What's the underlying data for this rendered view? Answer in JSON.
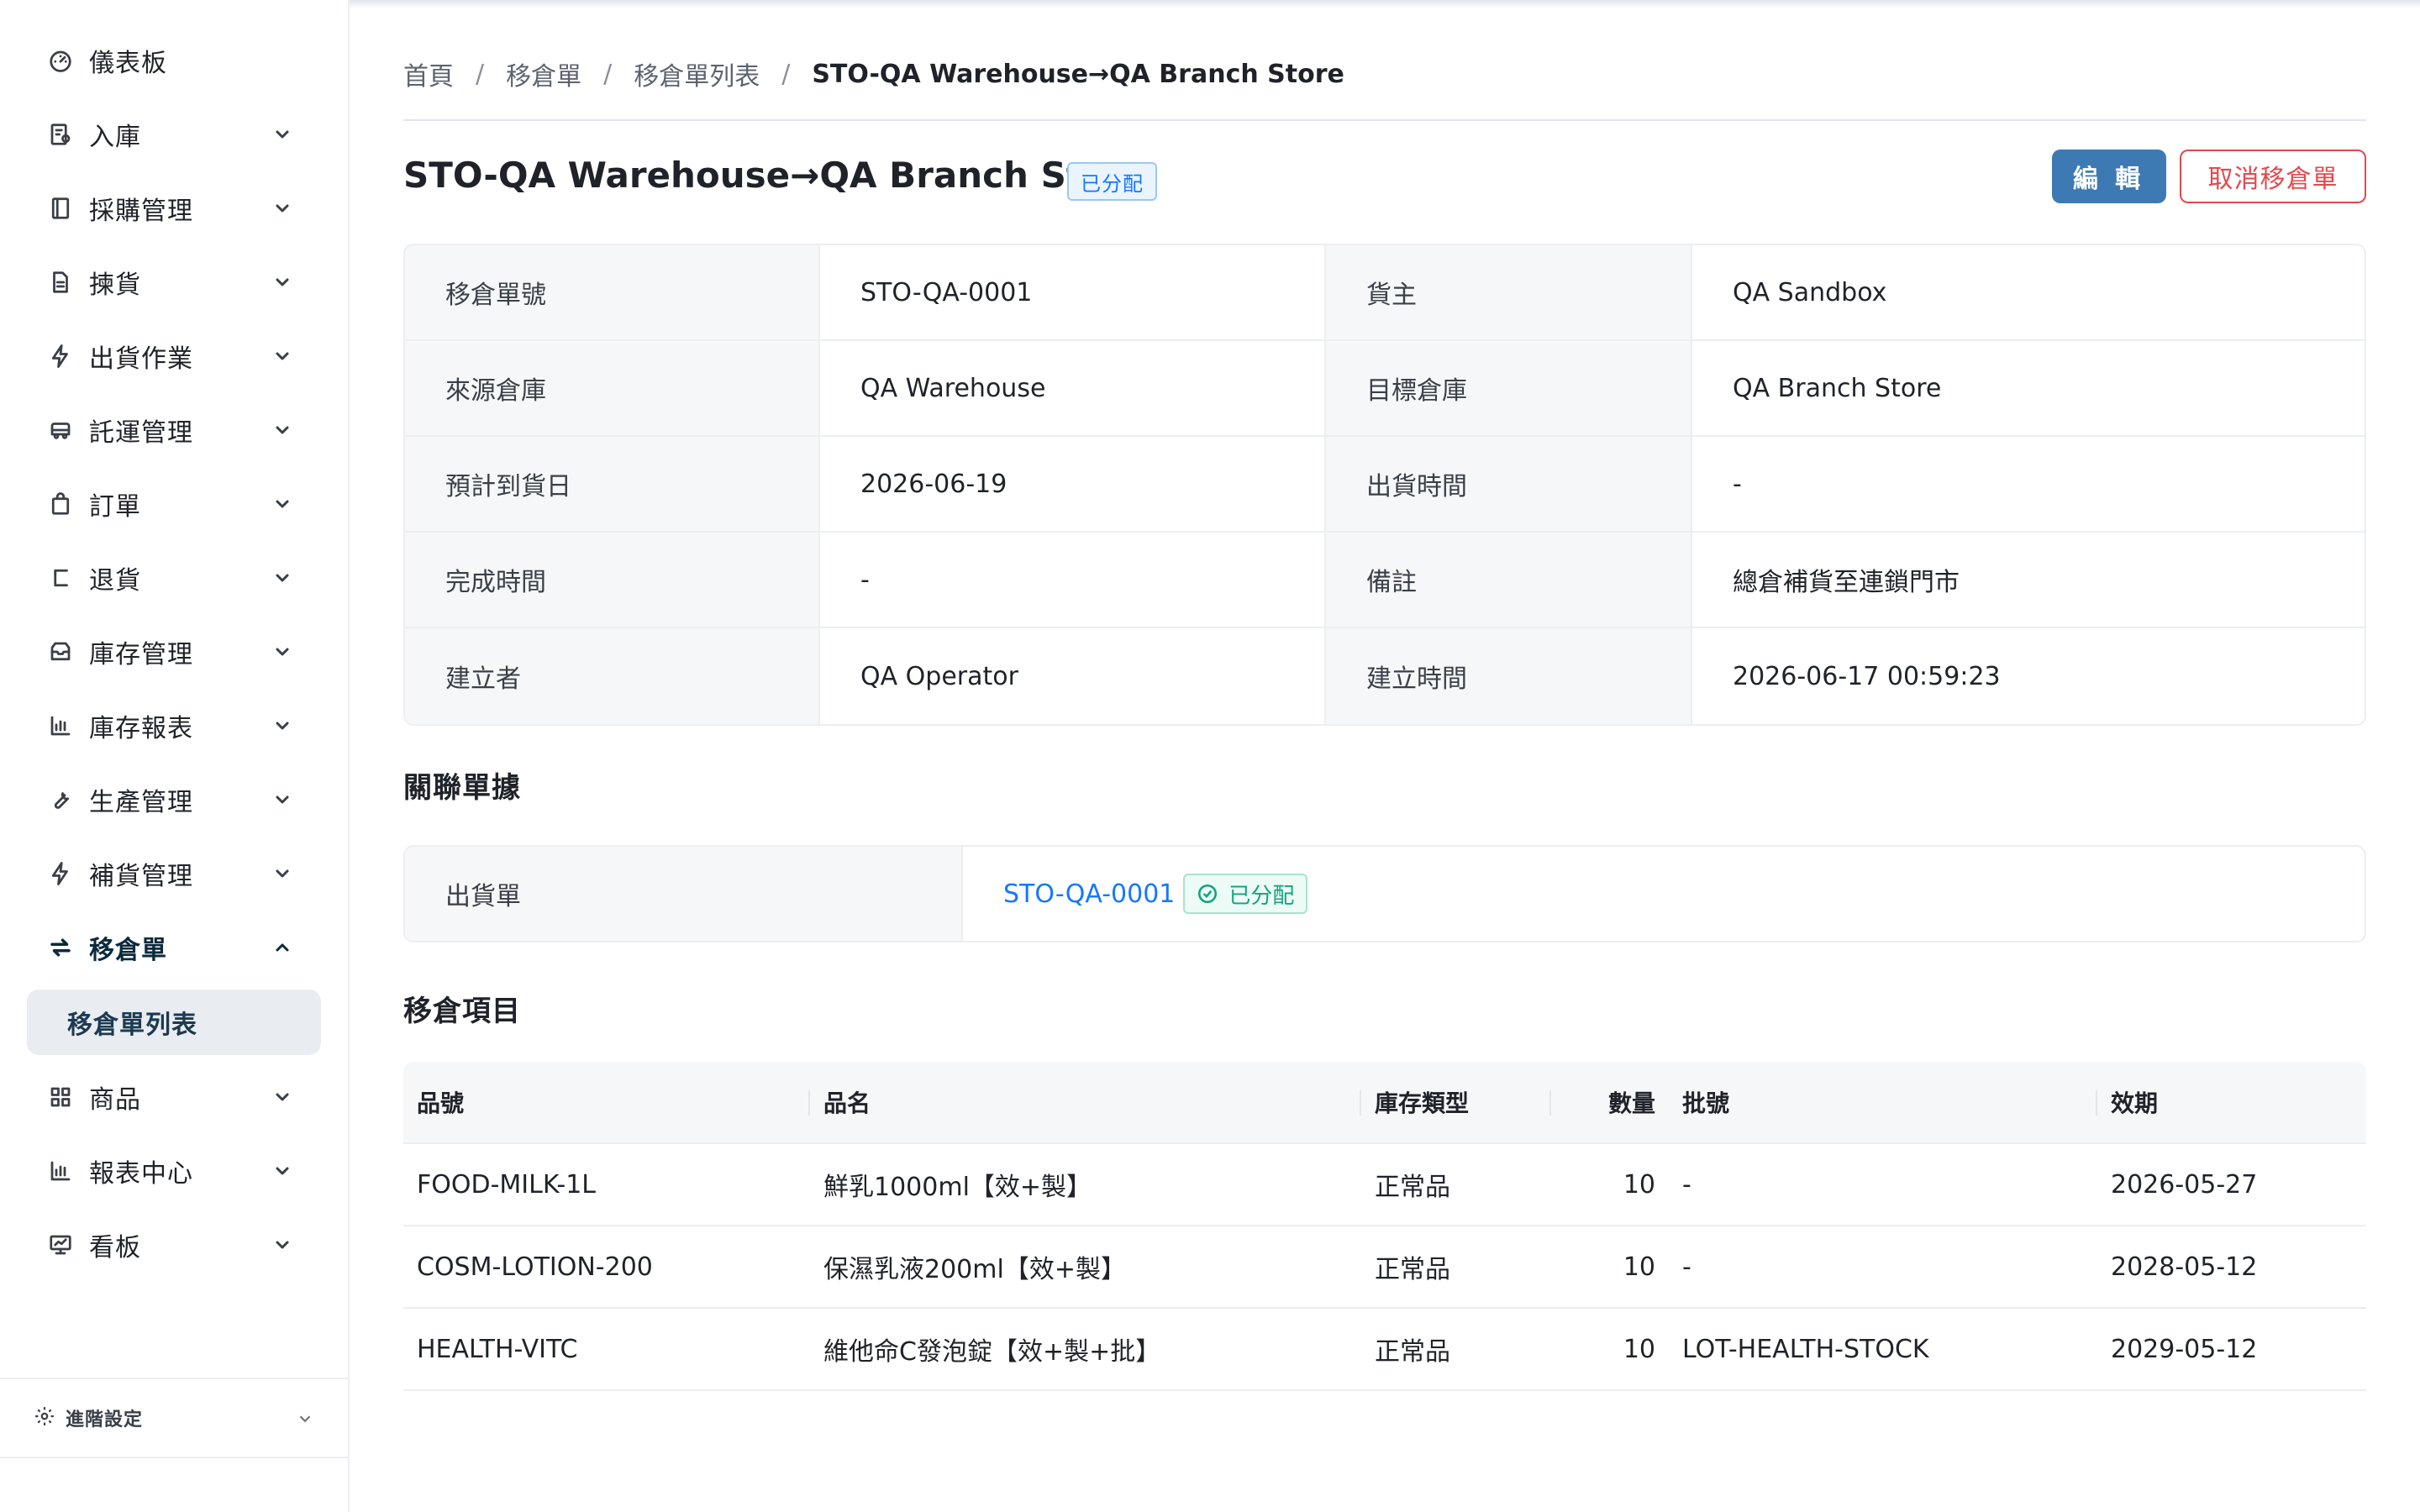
{
  "sidebar": {
    "items": [
      {
        "label": "儀表板",
        "icon": "gauge-icon",
        "expandable": false
      },
      {
        "label": "入庫",
        "icon": "inbound-icon",
        "expandable": true
      },
      {
        "label": "採購管理",
        "icon": "book-icon",
        "expandable": true
      },
      {
        "label": "揀貨",
        "icon": "document-icon",
        "expandable": true
      },
      {
        "label": "出貨作業",
        "icon": "lightning-icon",
        "expandable": true
      },
      {
        "label": "託運管理",
        "icon": "truck-icon",
        "expandable": true
      },
      {
        "label": "訂單",
        "icon": "bag-icon",
        "expandable": true
      },
      {
        "label": "退貨",
        "icon": "return-icon",
        "expandable": true
      },
      {
        "label": "庫存管理",
        "icon": "inbox-icon",
        "expandable": true
      },
      {
        "label": "庫存報表",
        "icon": "bar-chart-icon",
        "expandable": true
      },
      {
        "label": "生產管理",
        "icon": "wrench-icon",
        "expandable": true
      },
      {
        "label": "補貨管理",
        "icon": "lightning-icon",
        "expandable": true
      },
      {
        "label": "移倉單",
        "icon": "swap-icon",
        "expandable": true,
        "active": true
      },
      {
        "label": "商品",
        "icon": "grid-icon",
        "expandable": true
      },
      {
        "label": "報表中心",
        "icon": "bar-chart-icon",
        "expandable": true
      },
      {
        "label": "看板",
        "icon": "monitor-icon",
        "expandable": true
      }
    ],
    "sub_item": "移倉單列表",
    "footer_label": "進階設定"
  },
  "breadcrumb": [
    "首頁",
    "移倉單",
    "移倉單列表",
    "STO-QA Warehouse→QA Branch Store"
  ],
  "header": {
    "title": "STO-QA Warehouse→QA Branch Store",
    "status": "已分配",
    "edit_label": "編 輯",
    "cancel_label": "取消移倉單"
  },
  "details": [
    {
      "l1": "移倉單號",
      "v1": "STO-QA-0001",
      "l2": "貨主",
      "v2": "QA Sandbox"
    },
    {
      "l1": "來源倉庫",
      "v1": "QA Warehouse",
      "l2": "目標倉庫",
      "v2": "QA Branch Store"
    },
    {
      "l1": "預計到貨日",
      "v1": "2026-06-19",
      "l2": "出貨時間",
      "v2": "-"
    },
    {
      "l1": "完成時間",
      "v1": "-",
      "l2": "備註",
      "v2": "總倉補貨至連鎖門市"
    },
    {
      "l1": "建立者",
      "v1": "QA Operator",
      "l2": "建立時間",
      "v2": "2026-06-17 00:59:23"
    }
  ],
  "related": {
    "title": "關聯單據",
    "label": "出貨單",
    "link": "STO-QA-0001",
    "status": "已分配"
  },
  "items": {
    "title": "移倉項目",
    "columns": [
      "品號",
      "品名",
      "庫存類型",
      "數量",
      "批號",
      "效期"
    ],
    "rows": [
      [
        "FOOD-MILK-1L",
        "鮮乳1000ml【效+製】",
        "正常品",
        "10",
        "-",
        "2026-05-27"
      ],
      [
        "COSM-LOTION-200",
        "保濕乳液200ml【效+製】",
        "正常品",
        "10",
        "-",
        "2028-05-12"
      ],
      [
        "HEALTH-VITC",
        "維他命C發泡錠【效+製+批】",
        "正常品",
        "10",
        "LOT-HEALTH-STOCK",
        "2029-05-12"
      ]
    ]
  },
  "colors": {
    "primary_button": "#3d7ab3",
    "link": "#1677ff",
    "danger": "#e5484d",
    "success": "#14a37f"
  }
}
